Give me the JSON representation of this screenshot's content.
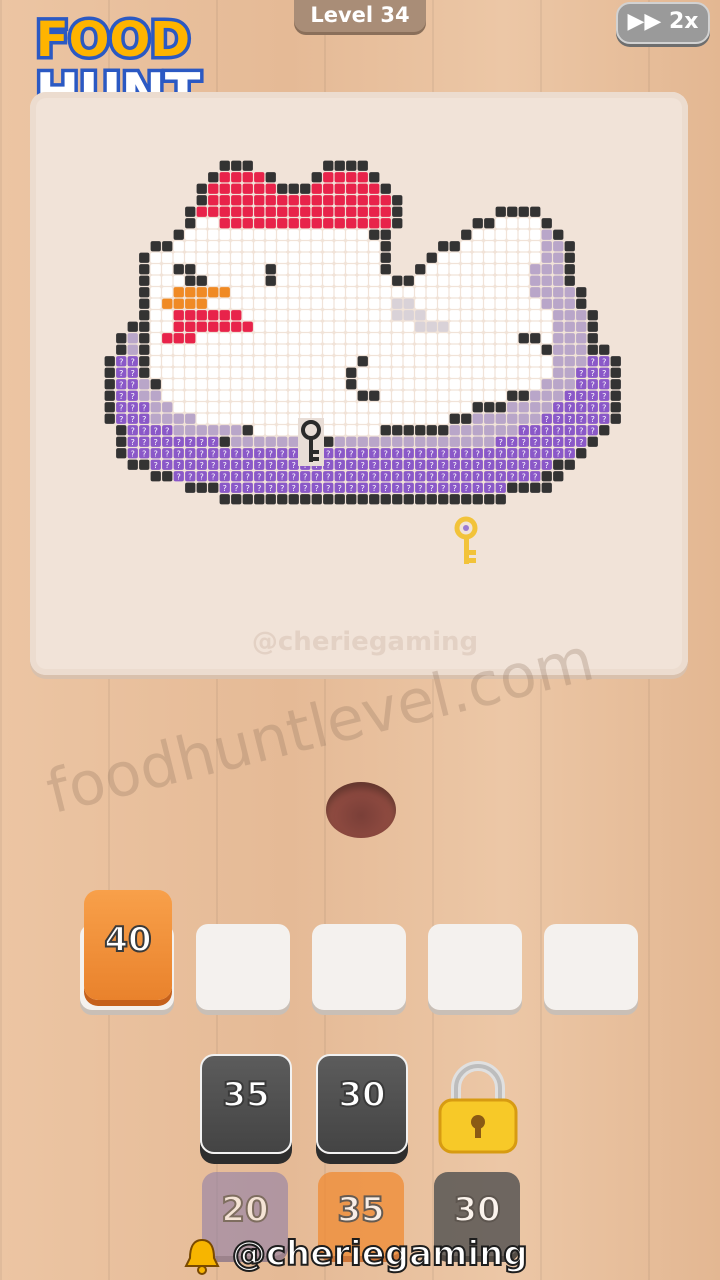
{
  "game": {
    "logo_line1": "FOOD",
    "logo_line2": "HUNT",
    "level_label": "Level 34",
    "speed_label": "2x"
  },
  "board": {
    "watermark": "@cheriegaming",
    "image": "pixel chicken",
    "hidden_cell_glyph": "?"
  },
  "site_watermark": "foodhuntlevel.com",
  "tray": {
    "slots": [
      {
        "value": "40",
        "color": "#f08b33"
      },
      {
        "value": ""
      },
      {
        "value": ""
      },
      {
        "value": ""
      },
      {
        "value": ""
      }
    ]
  },
  "queue": {
    "row1": [
      {
        "value": "35",
        "color": "#4f4f4f"
      },
      {
        "value": "30",
        "color": "#4f4f4f"
      },
      {
        "locked": true,
        "icon": "padlock-icon"
      }
    ],
    "row2": [
      {
        "value": "20",
        "color": "#8f7fa8"
      },
      {
        "value": "35",
        "color": "#f08b33"
      },
      {
        "value": "30",
        "color": "#4f4f4f"
      }
    ]
  },
  "footer": {
    "handle": "@cheriegaming",
    "icon": "bell-icon"
  },
  "colors": {
    "comb": "#e8234a",
    "beak": "#f08a24",
    "white": "#ffffff",
    "outline": "#333333",
    "purple": "#8a58c8",
    "lilac": "#b9a6c9",
    "key_gold": "#f2c33a"
  }
}
